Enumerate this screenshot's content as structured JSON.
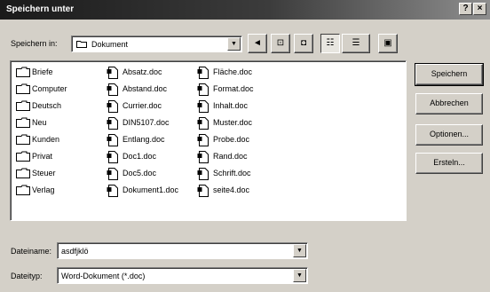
{
  "window": {
    "title": "Speichern unter",
    "help_button": "?",
    "close_button": "×"
  },
  "lookin": {
    "label": "Speichern in:",
    "value": "Dokument",
    "arrow": "▼"
  },
  "toolbar": {
    "up_folder": "◄",
    "desktop": "⊡",
    "new_folder": "◘",
    "list_view": "☷",
    "details_view": "☰",
    "properties": "▣"
  },
  "files": {
    "col1": [
      {
        "name": "Briefe",
        "type": "folder"
      },
      {
        "name": "Computer",
        "type": "folder"
      },
      {
        "name": "Deutsch",
        "type": "folder"
      },
      {
        "name": "Neu",
        "type": "folder"
      },
      {
        "name": "Kunden",
        "type": "folder"
      },
      {
        "name": "Privat",
        "type": "folder"
      },
      {
        "name": "Steuer",
        "type": "folder"
      },
      {
        "name": "Verlag",
        "type": "folder"
      }
    ],
    "col2": [
      {
        "name": "Absatz.doc",
        "type": "doc"
      },
      {
        "name": "Abstand.doc",
        "type": "doc"
      },
      {
        "name": "Currier.doc",
        "type": "doc"
      },
      {
        "name": "DIN5107.doc",
        "type": "doc"
      },
      {
        "name": "Entlang.doc",
        "type": "doc"
      },
      {
        "name": "Doc1.doc",
        "type": "doc"
      },
      {
        "name": "Doc5.doc",
        "type": "doc"
      },
      {
        "name": "Dokument1.doc",
        "type": "doc"
      }
    ],
    "col3": [
      {
        "name": "Fläche.doc",
        "type": "doc"
      },
      {
        "name": "Format.doc",
        "type": "doc"
      },
      {
        "name": "Inhalt.doc",
        "type": "doc"
      },
      {
        "name": "Muster.doc",
        "type": "doc"
      },
      {
        "name": "Probe.doc",
        "type": "doc"
      },
      {
        "name": "Rand.doc",
        "type": "doc"
      },
      {
        "name": "Schrift.doc",
        "type": "doc"
      },
      {
        "name": "seite4.doc",
        "type": "doc"
      }
    ]
  },
  "buttons": {
    "save": "Speichern",
    "cancel": "Abbrechen",
    "options": "Optionen...",
    "more": "Ersteln..."
  },
  "filename": {
    "label": "Dateiname:",
    "value": "asdfjklö"
  },
  "filetype": {
    "label": "Dateityp:",
    "value": "Word-Dokument (*.doc)"
  },
  "colors": {
    "face": "#d4d0c8",
    "titlebar_dark": "#1a1a1a",
    "window_bg": "#ffffff"
  }
}
